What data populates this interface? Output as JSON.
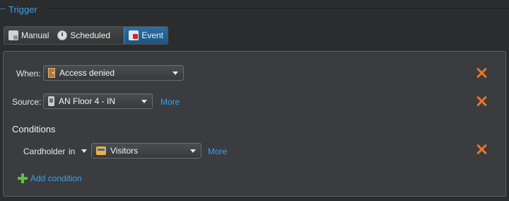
{
  "section": {
    "title": "Trigger"
  },
  "modes": [
    {
      "label": "Manual",
      "icon": "manual-icon"
    },
    {
      "label": "Scheduled",
      "icon": "scheduled-icon"
    },
    {
      "label": "Event",
      "icon": "event-icon",
      "selected": true
    }
  ],
  "when": {
    "label": "When:",
    "value": "Access denied",
    "icon": "door-icon"
  },
  "source": {
    "label": "Source:",
    "value": "AN Floor 4 - IN",
    "icon": "reader-icon",
    "more": "More"
  },
  "conditions": {
    "heading": "Conditions",
    "field": "Cardholder",
    "operator": "in",
    "value": "Visitors",
    "icon": "visitors-icon",
    "more": "More",
    "add_label": "Add condition"
  },
  "colors": {
    "accent": "#3aa0e8",
    "remove": "#e8742a",
    "add": "#5cc43a",
    "selected_mode": "#1d5584"
  }
}
